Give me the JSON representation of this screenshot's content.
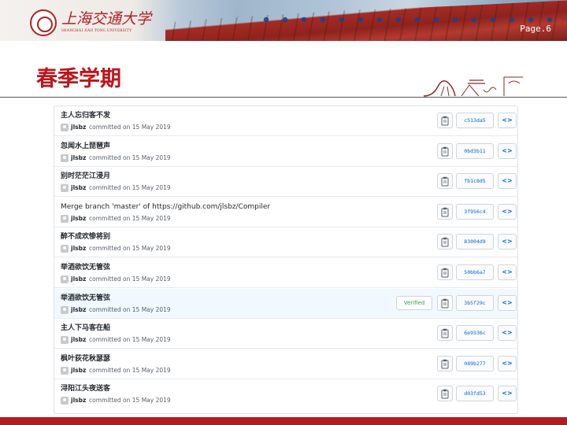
{
  "header": {
    "logo_cn": "上海交通大学",
    "logo_en": "SHANGHAI JIAO TONG UNIVERSITY",
    "page_label": "Page.6"
  },
  "title": "春季学期",
  "commits": [
    {
      "message": "主人忘归客不发",
      "author": "jlsbz",
      "date": "committed on 15 May 2019",
      "sha": "c513da5",
      "verified": ""
    },
    {
      "message": "忽闻水上琵琶声",
      "author": "jlsbz",
      "date": "committed on 15 May 2019",
      "sha": "0bd3b11",
      "verified": ""
    },
    {
      "message": "别时茫茫江浸月",
      "author": "jlsbz",
      "date": "committed on 15 May 2019",
      "sha": "fb1c8d5",
      "verified": ""
    },
    {
      "message": "Merge branch 'master' of https://github.com/jlsbz/Compiler",
      "author": "jlsbz",
      "date": "committed on 15 May 2019",
      "sha": "3f956c4",
      "verified": ""
    },
    {
      "message": "醉不成欢惨将别",
      "author": "jlsbz",
      "date": "committed on 15 May 2019",
      "sha": "83004d9",
      "verified": ""
    },
    {
      "message": "举酒欲饮无管弦",
      "author": "jlsbz",
      "date": "committed on 15 May 2019",
      "sha": "50bb6a7",
      "verified": ""
    },
    {
      "message": "举酒欲饮无管弦",
      "author": "jlsbz",
      "date": "committed on 15 May 2019",
      "sha": "3b5f29c",
      "verified": "Verified"
    },
    {
      "message": "主人下马客在船",
      "author": "jlsbz",
      "date": "committed on 15 May 2019",
      "sha": "6e9336c",
      "verified": ""
    },
    {
      "message": "枫叶荻花秋瑟瑟",
      "author": "jlsbz",
      "date": "committed on 15 May 2019",
      "sha": "089b277",
      "verified": ""
    },
    {
      "message": "浔阳江头夜送客",
      "author": "jlsbz",
      "date": "committed on 15 May 2019",
      "sha": "d03fd53",
      "verified": ""
    }
  ],
  "icons": {
    "copy": "clipboard-icon",
    "browse": "code-icon",
    "avatar": "avatar-icon"
  },
  "colors": {
    "accent_red": "#c0141c",
    "link_blue": "#0366d6",
    "verified_green": "#28a745"
  }
}
